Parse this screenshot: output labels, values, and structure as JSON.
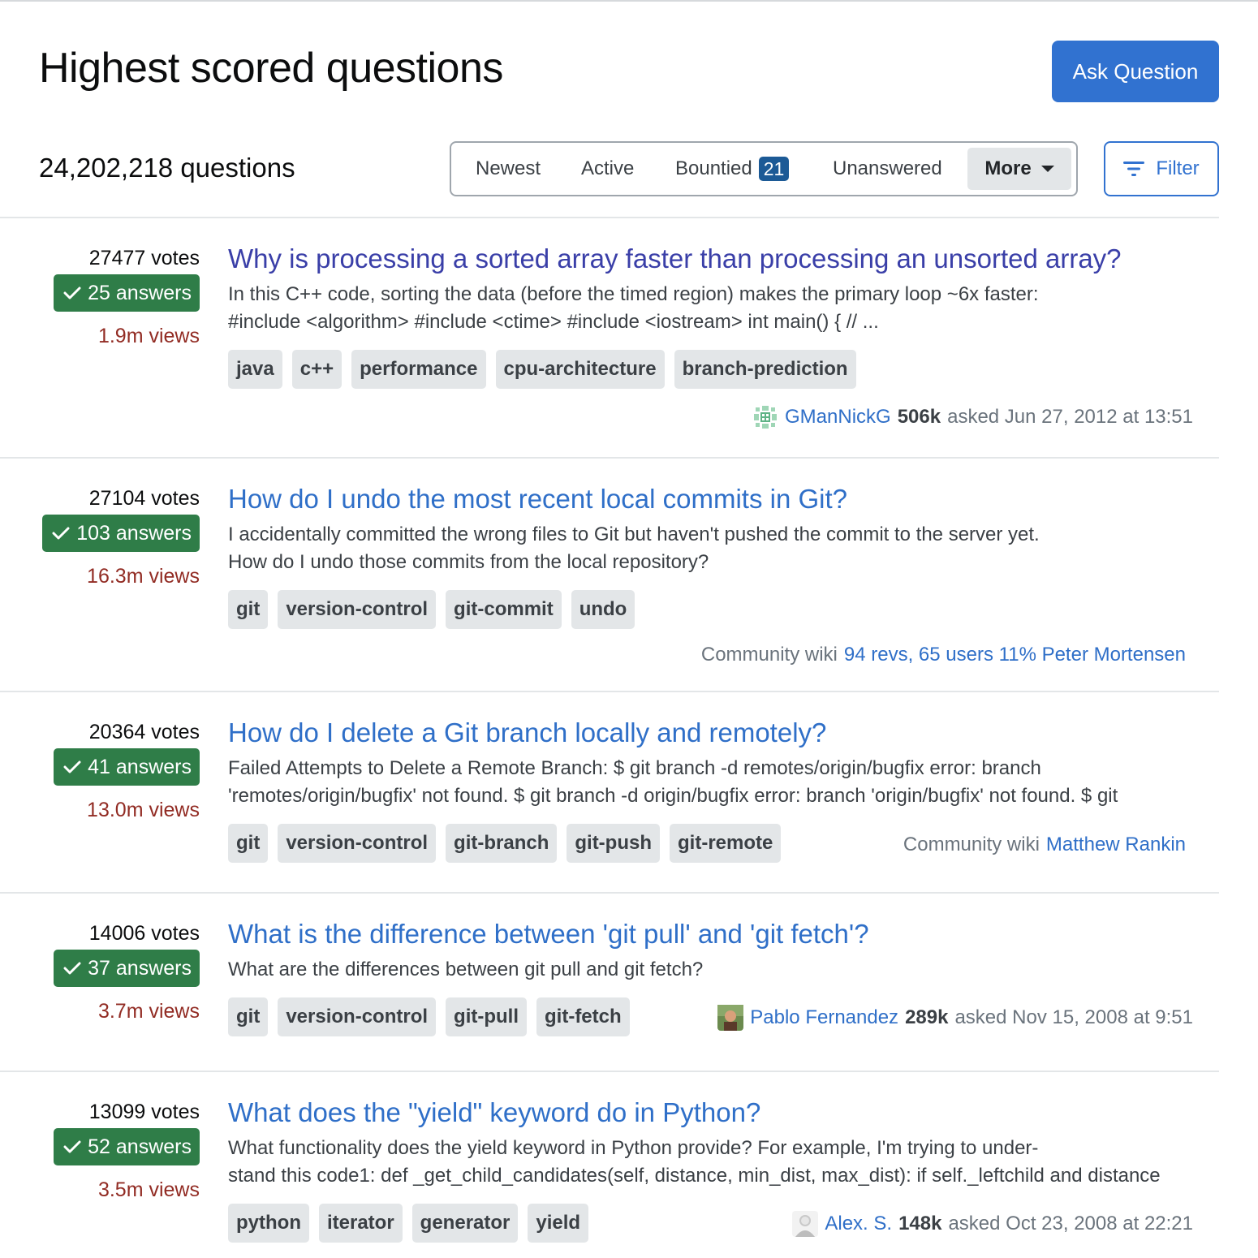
{
  "header": {
    "title": "Highest scored questions",
    "ask_button": "Ask Question",
    "question_count": "24,202,218 questions",
    "accent_color": "#3172d0"
  },
  "tabs": {
    "newest": "Newest",
    "active": "Active",
    "bountied": "Bountied",
    "bountied_count": "21",
    "unanswered": "Unanswered",
    "more": "More",
    "filter": "Filter"
  },
  "questions": [
    {
      "votes": "27477 votes",
      "answers": "25 answers",
      "views": "1.9m views",
      "title": "Why is processing a sorted array faster than processing an unsorted array?",
      "excerpt_line1": "In this C++ code, sorting the data (before the timed region) makes the primary loop ~6x faster:",
      "excerpt_line2": "#include <algorithm> #include <ctime> #include <iostream> int main() { // ...",
      "tags": [
        "java",
        "c++",
        "performance",
        "cpu-architecture",
        "branch-prediction"
      ],
      "user": "GManNickG",
      "rep": "506k",
      "asked": "asked Jun 27, 2012 at 13:51"
    },
    {
      "votes": "27104 votes",
      "answers": "103 answers",
      "views": "16.3m views",
      "title": "How do I undo the most recent local commits in Git?",
      "excerpt_line1": "I accidentally committed the wrong files to Git but haven't pushed the commit to the server yet.",
      "excerpt_line2": "How do I undo those commits from the local repository?",
      "tags": [
        "git",
        "version-control",
        "git-commit",
        "undo"
      ],
      "wiki_label": "Community wiki",
      "wiki_revs": "94 revs, 65 users 11% Peter Mortensen"
    },
    {
      "votes": "20364 votes",
      "answers": "41 answers",
      "views": "13.0m views",
      "title": "How do I delete a Git branch locally and remotely?",
      "excerpt_line1": "Failed Attempts to Delete a Remote Branch: $ git branch -d remotes/origin/bugfix error: branch",
      "excerpt_line2": "'remotes/origin/bugfix' not found. $ git branch -d origin/bugfix error: branch 'origin/bugfix' not found. $ git",
      "tags": [
        "git",
        "version-control",
        "git-branch",
        "git-push",
        "git-remote"
      ],
      "wiki_label": "Community wiki",
      "wiki_user": "Matthew Rankin"
    },
    {
      "votes": "14006 votes",
      "answers": "37 answers",
      "views": "3.7m views",
      "title": "What is the difference between 'git pull' and 'git fetch'?",
      "excerpt_line1": "What are the differences between git pull and git fetch?",
      "tags": [
        "git",
        "version-control",
        "git-pull",
        "git-fetch"
      ],
      "user": "Pablo Fernandez",
      "rep": "289k",
      "asked": "asked Nov 15, 2008 at 9:51"
    },
    {
      "votes": "13099 votes",
      "answers": "52 answers",
      "views": "3.5m views",
      "title": "What does the \"yield\" keyword do in Python?",
      "excerpt_line1": "What functionality does the yield keyword in Python provide? For example, I'm trying to under-",
      "excerpt_line2": "stand this code1: def _get_child_candidates(self, distance, min_dist, max_dist): if self._leftchild and distance",
      "tags": [
        "python",
        "iterator",
        "generator",
        "yield"
      ],
      "user": "Alex. S.",
      "rep": "148k",
      "asked": "asked Oct 23, 2008 at 22:21"
    }
  ]
}
